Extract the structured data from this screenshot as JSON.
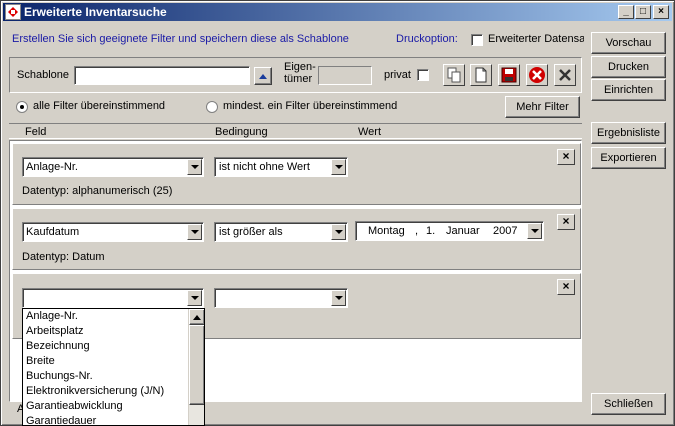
{
  "window": {
    "title": "Erweiterte Inventarsuche"
  },
  "header": {
    "hint": "Erstellen Sie sich geeignete Filter und speichern diese als Schablone",
    "druck_label": "Druckoption:",
    "druck_checkbox": "Erweiterter Datensat"
  },
  "schablone": {
    "label": "Schablone",
    "value": "",
    "eigen_label1": "Eigen-",
    "eigen_label2": "tümer",
    "eigen_value": "",
    "privat_label": "privat"
  },
  "match": {
    "all": "alle Filter übereinstimmend",
    "any": "mindest. ein Filter übereinstimmend",
    "mehr": "Mehr Filter"
  },
  "columns": {
    "feld": "Feld",
    "bedingung": "Bedingung",
    "wert": "Wert"
  },
  "filters": [
    {
      "feld": "Anlage-Nr.",
      "bedingung": "ist nicht ohne Wert",
      "datentyp": "Datentyp:  alphanumerisch (25)"
    },
    {
      "feld": "Kaufdatum",
      "bedingung": "ist größer als",
      "datentyp": "Datentyp:  Datum",
      "date": {
        "weekday": "Montag",
        "sep": ",",
        "day": "1.",
        "month": "Januar",
        "year": "2007"
      }
    },
    {
      "feld": "",
      "bedingung": ""
    }
  ],
  "dropdown_list": [
    "Anlage-Nr.",
    "Arbeitsplatz",
    "Bezeichnung",
    "Breite",
    "Buchungs-Nr.",
    "Elektronikversicherung (J/N)",
    "Garantieabwicklung",
    "Garantiedauer"
  ],
  "footer_partial": "A",
  "side_buttons": {
    "vorschau": "Vorschau",
    "drucken": "Drucken",
    "einrichten": "Einrichten",
    "ergebnisliste": "Ergebnisliste",
    "exportieren": "Exportieren",
    "schliessen": "Schließen"
  },
  "colors": {
    "title_start": "#0a246a",
    "title_end": "#a6caf0",
    "hint_blue": "#1a1aa6",
    "delete_red": "#c00000"
  }
}
